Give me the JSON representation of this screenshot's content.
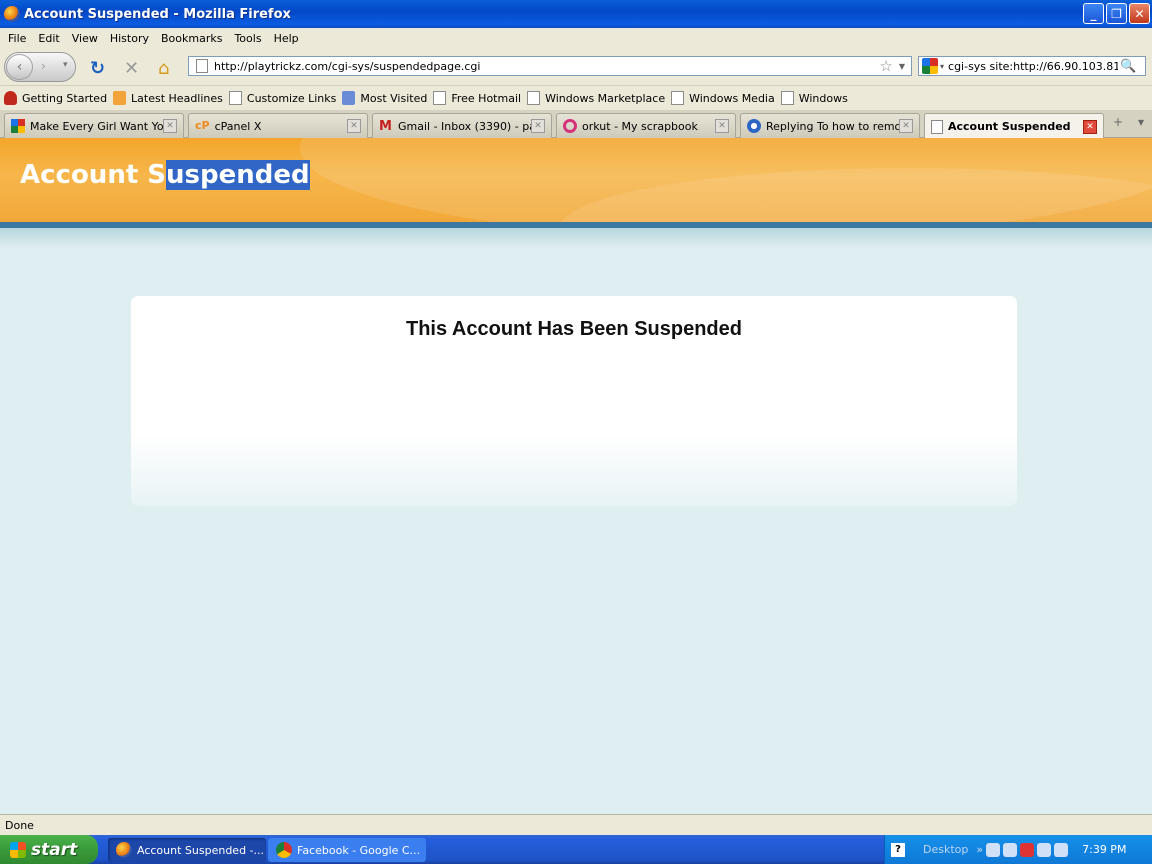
{
  "window": {
    "title": "Account Suspended - Mozilla Firefox"
  },
  "menu": [
    "File",
    "Edit",
    "View",
    "History",
    "Bookmarks",
    "Tools",
    "Help"
  ],
  "nav": {
    "url": "http://playtrickz.com/cgi-sys/suspendedpage.cgi",
    "search_value": "cgi-sys site:http://66.90.103.81:20"
  },
  "bookmarks": [
    "Getting Started",
    "Latest Headlines",
    "Customize Links",
    "Most Visited",
    "Free Hotmail",
    "Windows Marketplace",
    "Windows Media",
    "Windows"
  ],
  "tabs": [
    {
      "label": "Make Every Girl Want Yo..."
    },
    {
      "label": "cPanel X"
    },
    {
      "label": "Gmail - Inbox (3390) - pa..."
    },
    {
      "label": "orkut - My scrapbook"
    },
    {
      "label": "Replying To how to remo..."
    },
    {
      "label": "Account Suspended"
    }
  ],
  "page": {
    "banner_prefix": "Account S",
    "banner_selected": "uspended",
    "heading": "This Account Has Been Suspended"
  },
  "status": {
    "text": "Done"
  },
  "taskbar": {
    "start": "start",
    "items": [
      "Account Suspended -...",
      "Facebook - Google C..."
    ],
    "desktop": "Desktop",
    "clock": "7:39 PM"
  }
}
